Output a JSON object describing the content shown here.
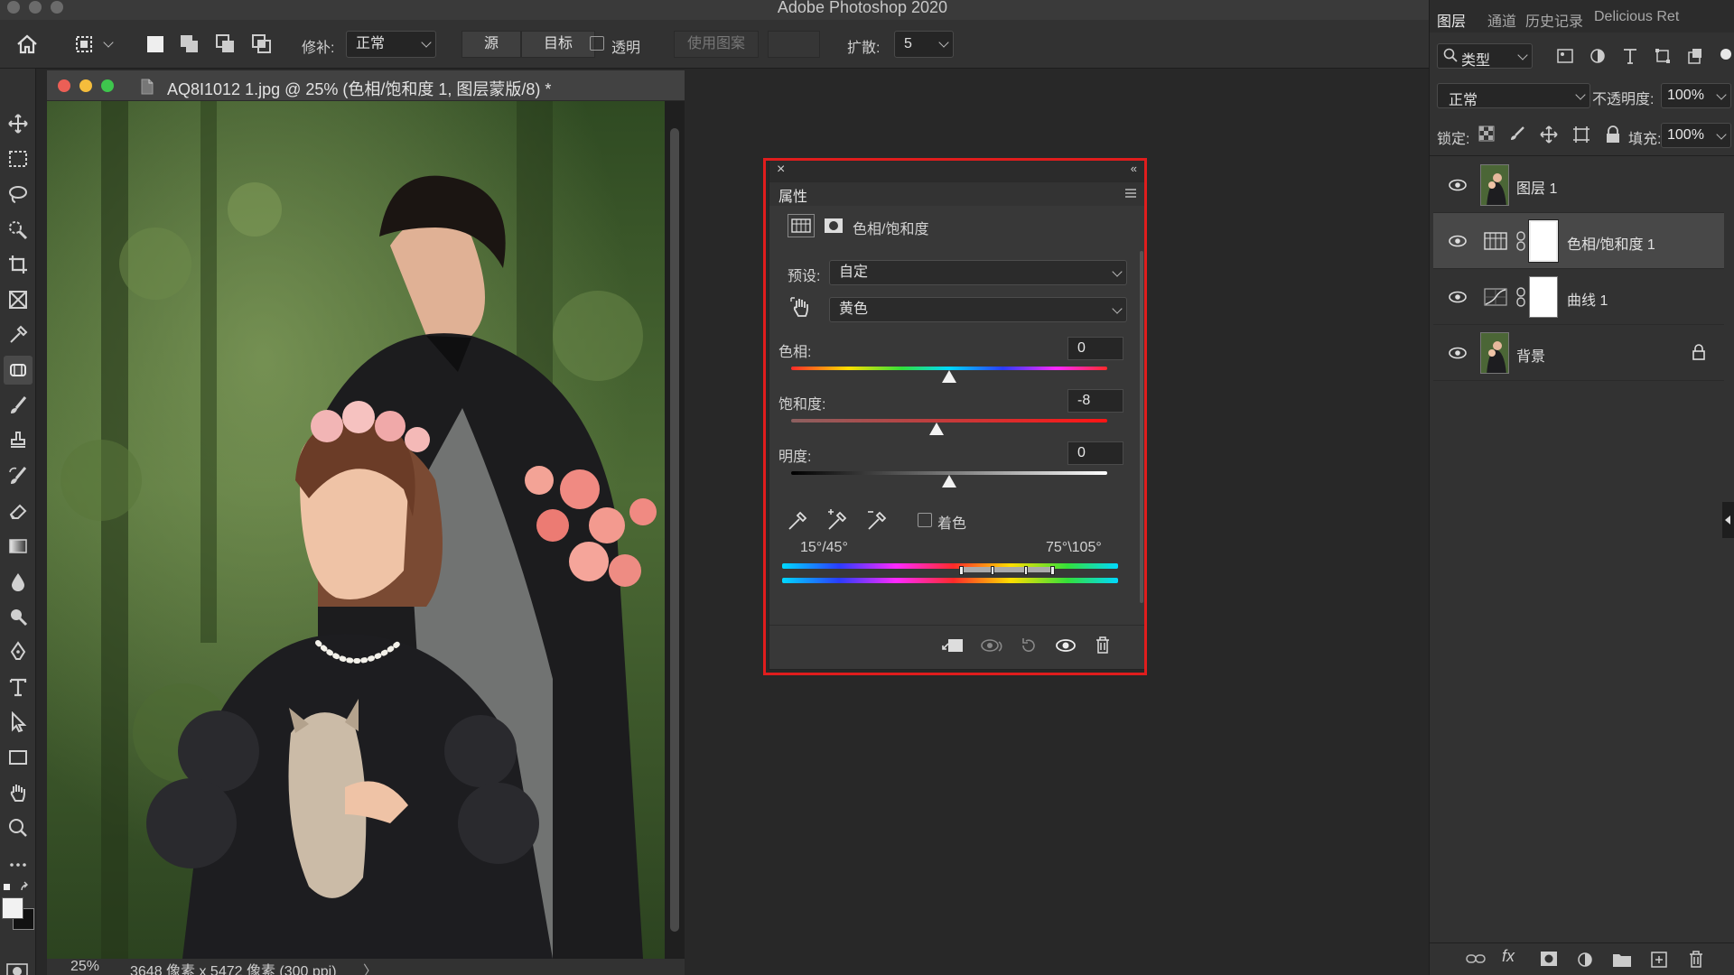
{
  "app": {
    "title": "Adobe Photoshop 2020"
  },
  "options_bar": {
    "repair_label": "修补:",
    "repair_mode": "正常",
    "source_button": "源",
    "target_button": "目标",
    "transparent_label": "透明",
    "use_pattern_button": "使用图案",
    "diffusion_label": "扩散:",
    "diffusion_value": "5"
  },
  "document": {
    "tab_title": "AQ8I1012 1.jpg @ 25% (色相/饱和度 1, 图层蒙版/8) *",
    "zoom": "25%",
    "dimensions": "3648 像素 x 5472 像素 (300 ppi)"
  },
  "properties": {
    "tab_label": "属性",
    "adjustment_name": "色相/饱和度",
    "preset_label": "预设:",
    "preset_value": "自定",
    "channel_value": "黄色",
    "hue_label": "色相:",
    "hue_value": "0",
    "saturation_label": "饱和度:",
    "saturation_value": "-8",
    "lightness_label": "明度:",
    "lightness_value": "0",
    "colorize_label": "着色",
    "colorize_checked": false,
    "range_left": "15°/45°",
    "range_right": "75°\\105°",
    "hue_slider_fraction": 0.5,
    "saturation_slider_fraction": 0.46,
    "lightness_slider_fraction": 0.5
  },
  "right_panel": {
    "tabs": [
      "图层",
      "通道",
      "历史记录",
      "Delicious Ret"
    ],
    "filter_label": "类型",
    "blend_mode": "正常",
    "opacity_label": "不透明度:",
    "opacity_value": "100%",
    "lock_label": "锁定:",
    "fill_label": "填充:",
    "fill_value": "100%",
    "layers": [
      {
        "name": "图层 1",
        "visible": true
      },
      {
        "name": "色相/饱和度 1",
        "visible": true,
        "selected": true
      },
      {
        "name": "曲线 1",
        "visible": true
      },
      {
        "name": "背景",
        "visible": true,
        "locked": true
      }
    ]
  },
  "colors": {
    "accent_red": "#e01d1d",
    "panel_bg": "#383838",
    "selected_layer": "#484848"
  }
}
